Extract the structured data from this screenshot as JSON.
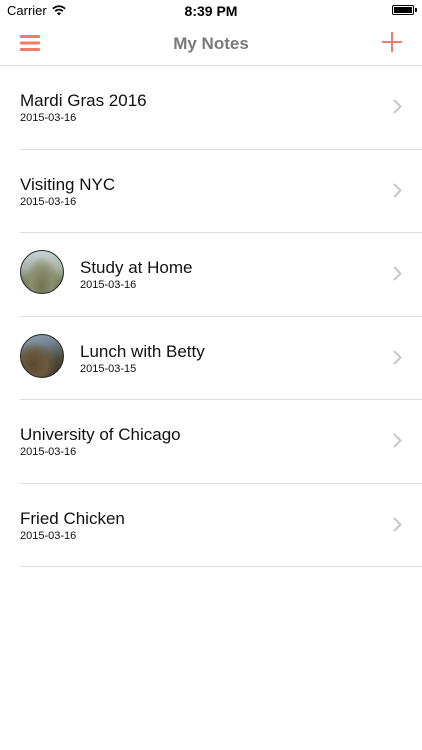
{
  "status_bar": {
    "carrier": "Carrier",
    "time": "8:39 PM",
    "battery_level": 1.0
  },
  "nav": {
    "title": "My Notes",
    "menu_icon": "hamburger-menu-icon",
    "add_icon": "plus-icon",
    "accent_color": "#f47a68"
  },
  "notes": [
    {
      "title": "Mardi Gras 2016",
      "date": "2015-03-16",
      "has_thumbnail": false
    },
    {
      "title": "Visiting NYC",
      "date": "2015-03-16",
      "has_thumbnail": false
    },
    {
      "title": "Study at Home",
      "date": "2015-03-16",
      "has_thumbnail": true
    },
    {
      "title": "Lunch with Betty",
      "date": "2015-03-15",
      "has_thumbnail": true
    },
    {
      "title": "University of Chicago",
      "date": "2015-03-16",
      "has_thumbnail": false
    },
    {
      "title": "Fried Chicken",
      "date": "2015-03-16",
      "has_thumbnail": false
    }
  ]
}
